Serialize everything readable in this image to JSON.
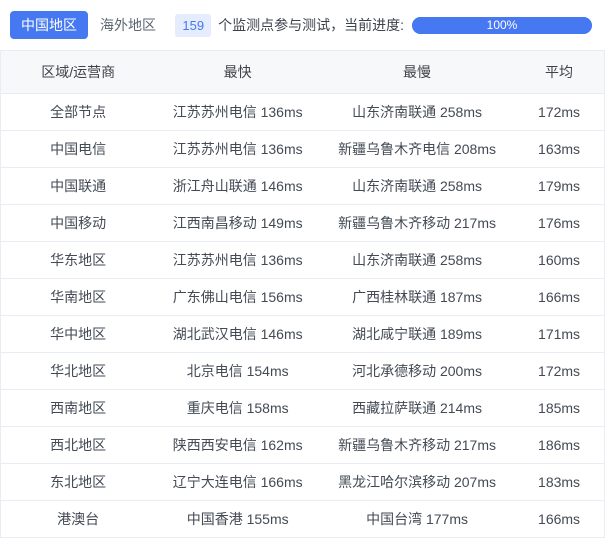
{
  "tabs": [
    {
      "label": "中国地区",
      "active": true
    },
    {
      "label": "海外地区",
      "active": false
    }
  ],
  "monitor": {
    "count": "159",
    "suffix_text": "个监测点参与测试，当前进度:",
    "progress_label": "100%",
    "progress_percent": 100
  },
  "colors": {
    "accent": "#4678f2",
    "badge_bg": "#e4ecfd",
    "header_bg": "#f7f8f9",
    "border": "#e9edf3",
    "text": "#434a54",
    "muted": "#5c6670"
  },
  "table": {
    "columns": [
      "区域/运营商",
      "最快",
      "最慢",
      "平均"
    ],
    "rows": [
      {
        "region": "全部节点",
        "fastest": "江苏苏州电信 136ms",
        "slowest": "山东济南联通 258ms",
        "avg": "172ms"
      },
      {
        "region": "中国电信",
        "fastest": "江苏苏州电信 136ms",
        "slowest": "新疆乌鲁木齐电信 208ms",
        "avg": "163ms"
      },
      {
        "region": "中国联通",
        "fastest": "浙江舟山联通 146ms",
        "slowest": "山东济南联通 258ms",
        "avg": "179ms"
      },
      {
        "region": "中国移动",
        "fastest": "江西南昌移动 149ms",
        "slowest": "新疆乌鲁木齐移动 217ms",
        "avg": "176ms"
      },
      {
        "region": "华东地区",
        "fastest": "江苏苏州电信 136ms",
        "slowest": "山东济南联通 258ms",
        "avg": "160ms"
      },
      {
        "region": "华南地区",
        "fastest": "广东佛山电信 156ms",
        "slowest": "广西桂林联通 187ms",
        "avg": "166ms"
      },
      {
        "region": "华中地区",
        "fastest": "湖北武汉电信 146ms",
        "slowest": "湖北咸宁联通 189ms",
        "avg": "171ms"
      },
      {
        "region": "华北地区",
        "fastest": "北京电信 154ms",
        "slowest": "河北承德移动 200ms",
        "avg": "172ms"
      },
      {
        "region": "西南地区",
        "fastest": "重庆电信 158ms",
        "slowest": "西藏拉萨联通 214ms",
        "avg": "185ms"
      },
      {
        "region": "西北地区",
        "fastest": "陕西西安电信 162ms",
        "slowest": "新疆乌鲁木齐移动 217ms",
        "avg": "186ms"
      },
      {
        "region": "东北地区",
        "fastest": "辽宁大连电信 166ms",
        "slowest": "黑龙江哈尔滨移动 207ms",
        "avg": "183ms"
      },
      {
        "region": "港澳台",
        "fastest": "中国香港 155ms",
        "slowest": "中国台湾 177ms",
        "avg": "166ms"
      }
    ]
  }
}
